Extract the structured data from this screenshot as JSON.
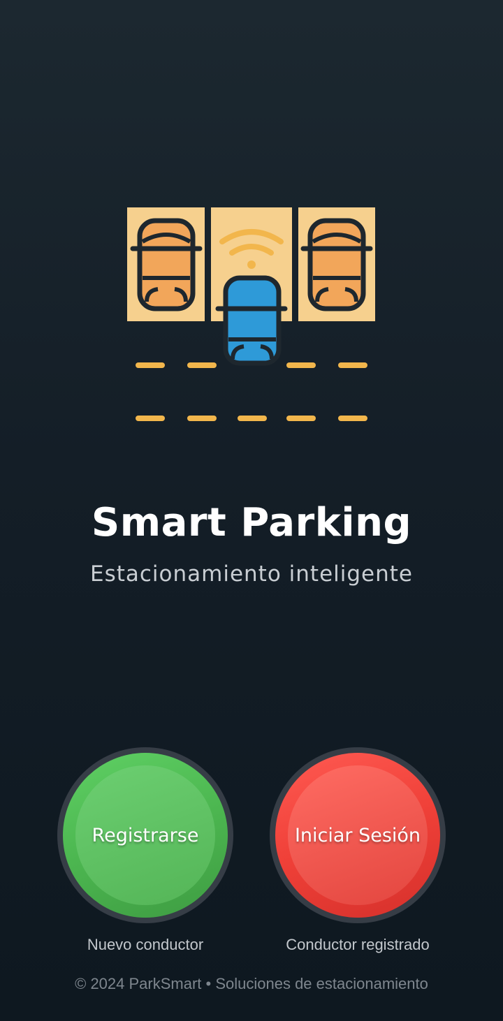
{
  "app": {
    "title": "Smart Parking",
    "subtitle": "Estacionamiento inteligente"
  },
  "hero_icon": "smart-parking-illustration",
  "actions": {
    "register": {
      "label": "Registrarse",
      "caption": "Nuevo conductor",
      "color": "#4cb650"
    },
    "login": {
      "label": "Iniciar Sesión",
      "caption": "Conductor registrado",
      "color": "#ef4038"
    }
  },
  "footer": "© 2024 ParkSmart • Soluciones de estacionamiento",
  "colors": {
    "background": "#141e27",
    "slot": "#f6d08e",
    "car_orange": "#f2a65a",
    "car_blue": "#2e9ad8",
    "road_dash": "#f2b64c"
  }
}
